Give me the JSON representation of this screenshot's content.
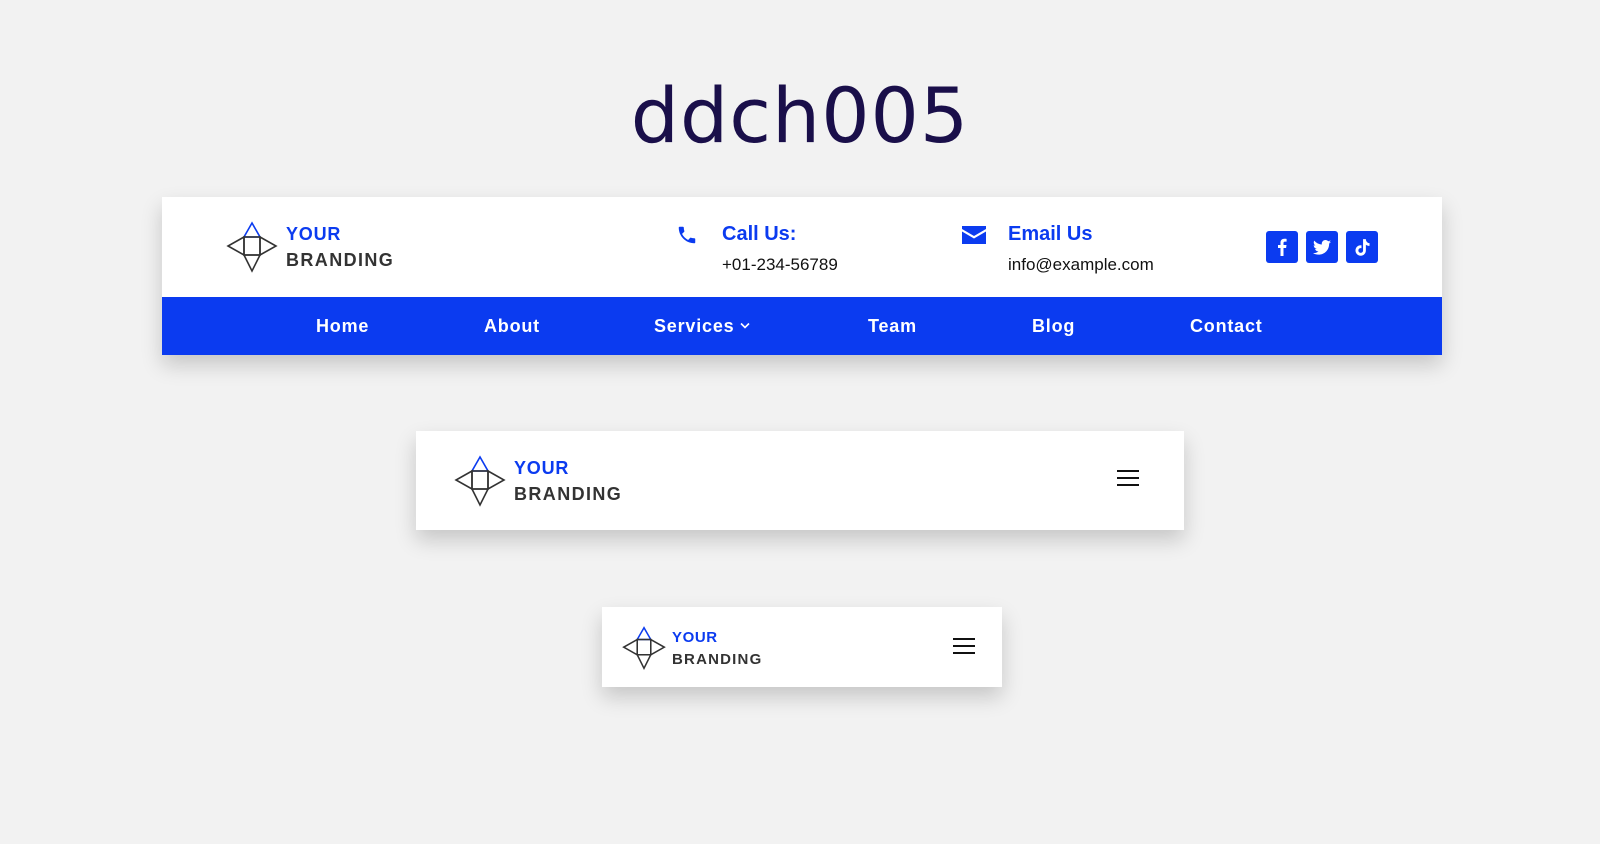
{
  "page": {
    "title": "ddch005"
  },
  "brand": {
    "line1": "YOUR",
    "line2": "BRANDING",
    "accent_color": "#0b3bf0",
    "text_color": "#333333"
  },
  "desktop": {
    "contact_phone": {
      "title": "Call Us:",
      "value": "+01-234-56789",
      "icon": "phone-icon"
    },
    "contact_email": {
      "title": "Email Us",
      "value": "info@example.com",
      "icon": "envelope-icon"
    },
    "social": [
      "facebook-icon",
      "twitter-icon",
      "tiktok-icon"
    ],
    "nav": {
      "background": "#0b3bf0",
      "items": [
        {
          "label": "Home"
        },
        {
          "label": "About"
        },
        {
          "label": "Services",
          "has_submenu": true
        },
        {
          "label": "Team"
        },
        {
          "label": "Blog"
        },
        {
          "label": "Contact"
        }
      ]
    }
  },
  "tablet": {
    "menu_icon": "hamburger-icon"
  },
  "mobile": {
    "menu_icon": "hamburger-icon"
  }
}
